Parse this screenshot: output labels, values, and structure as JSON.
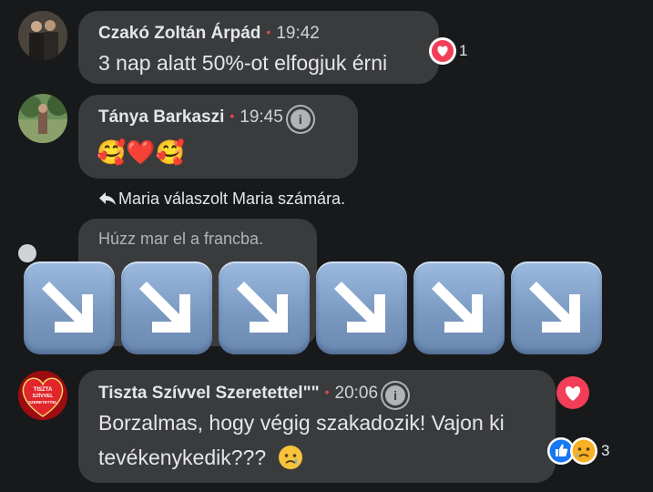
{
  "comments": [
    {
      "author": "Czakó Zoltán Árpád",
      "time": "19:42",
      "text": "3 nap alatt 50%-ot elfogjuk érni",
      "reaction_count": "1"
    },
    {
      "author": "Tánya Barkaszi",
      "time": "19:45",
      "text": "🥰❤️🥰"
    },
    {
      "reply_notice": "Maria válaszolt Maria számára.",
      "text": "Húzz mar el a francba."
    },
    {
      "author": "Tiszta Szívvel Szeretettel\"\"",
      "time": "20:06",
      "text_line1": "Borzalmas, hogy végig szakadozik! Vajon ki",
      "text_line2": "tevékenykedik???",
      "reaction_count": "3",
      "avatar_text": [
        "TISZTA",
        "SZÍVVEL",
        "SZERETETTEL"
      ]
    }
  ],
  "overlay": {
    "arrow_emoji_count": 6,
    "icon": "down-right-arrow-emoji"
  },
  "colors": {
    "background": "#18191a",
    "bubble": "#3a3b3c",
    "text": "#e4e6eb",
    "love_red": "#f33e58",
    "like_blue": "#1877f2"
  }
}
